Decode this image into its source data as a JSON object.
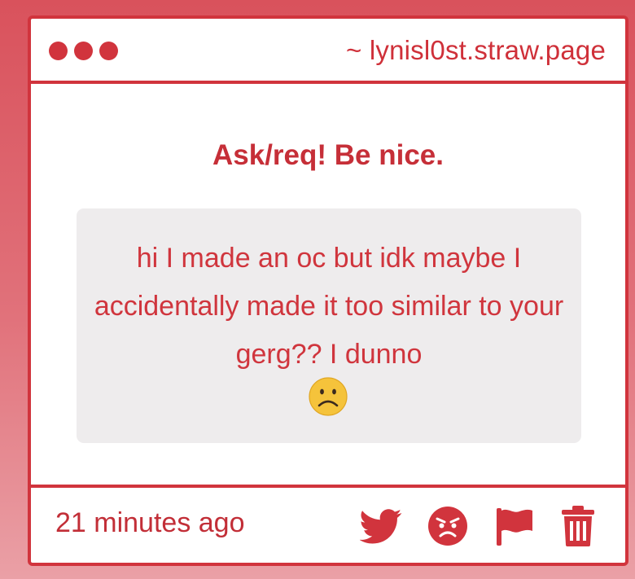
{
  "window": {
    "url": "~ lynisl0st.straw.page"
  },
  "question": {
    "heading": "Ask/req! Be nice.",
    "message": "hi I made an oc but idk maybe I accidentally made it too similar to your gerg?? I dunno",
    "emoji_icon": "frowning-face-icon"
  },
  "footer": {
    "timestamp": "21 minutes ago",
    "actions": [
      {
        "name": "share-twitter",
        "icon": "twitter-bird-icon"
      },
      {
        "name": "angry-reaction",
        "icon": "angry-face-icon"
      },
      {
        "name": "report",
        "icon": "flag-icon"
      },
      {
        "name": "delete",
        "icon": "trash-icon"
      }
    ]
  },
  "colors": {
    "accent": "#d1343d",
    "text_accent": "#cf3039",
    "message_background": "#eeeced",
    "emoji_yellow": "#f5c33b"
  }
}
